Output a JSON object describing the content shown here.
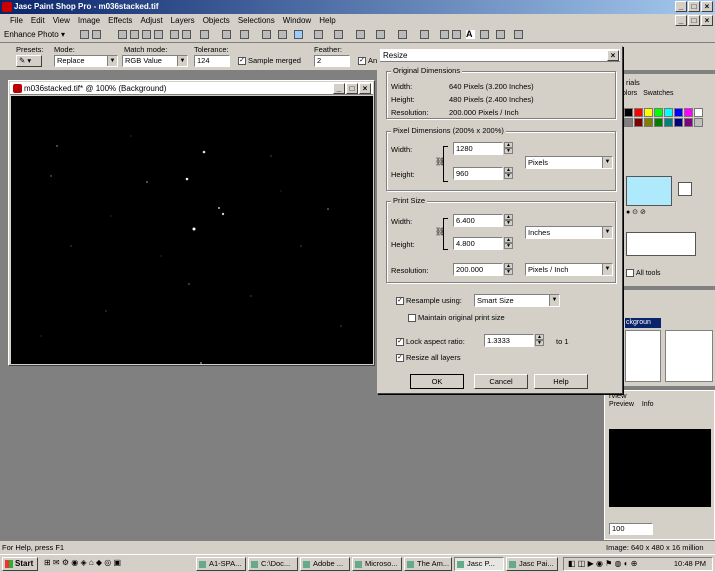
{
  "app": {
    "title": "Jasc Paint Shop Pro - m036stacked.tif",
    "menu": [
      "File",
      "Edit",
      "View",
      "Image",
      "Effects",
      "Adjust",
      "Layers",
      "Objects",
      "Selections",
      "Window",
      "Help"
    ],
    "enhance_label": "Enhance Photo",
    "icons": [
      "eye-icon",
      "arrow-icon",
      "selection-icon",
      "crop-icon",
      "move-icon",
      "wand-icon",
      "brush-icon",
      "clone-icon",
      "eraser-icon",
      "fill-icon",
      "text-icon",
      "pen-icon"
    ]
  },
  "options_bar": {
    "presets_label": "Presets:",
    "mode_label": "Mode:",
    "mode_value": "Replace",
    "match_label": "Match mode:",
    "match_value": "RGB Value",
    "tolerance_label": "Tolerance:",
    "tolerance_value": "124",
    "sample_merged": "Sample merged",
    "feather_label": "Feather:",
    "feather_value": "2",
    "antialias_label": "Ant"
  },
  "image_window": {
    "title": "m036stacked.tif* @ 100% (Background)"
  },
  "dialog": {
    "title": "Resize",
    "original": {
      "label": "Original Dimensions",
      "width_label": "Width:",
      "width_value": "640 Pixels (3.200 Inches)",
      "height_label": "Height:",
      "height_value": "480 Pixels (2.400 Inches)",
      "res_label": "Resolution:",
      "res_value": "200.000 Pixels / Inch"
    },
    "pixel": {
      "label": "Pixel Dimensions (200% x 200%)",
      "width_label": "Width:",
      "width_value": "1280",
      "height_label": "Height:",
      "height_value": "960",
      "unit": "Pixels"
    },
    "print": {
      "label": "Print Size",
      "width_label": "Width:",
      "width_value": "6.400",
      "height_label": "Height:",
      "height_value": "4.800",
      "unit": "Inches",
      "res_label": "Resolution:",
      "res_value": "200.000",
      "res_unit": "Pixels / Inch"
    },
    "resample_label": "Resample using:",
    "resample_value": "Smart Size",
    "maintain_label": "Maintain original print size",
    "lock_label": "Lock aspect ratio:",
    "lock_value": "1.3333",
    "lock_suffix": "to 1",
    "resize_layers_label": "Resize all layers",
    "ok": "OK",
    "cancel": "Cancel",
    "help": "Help"
  },
  "palettes": {
    "materials_tab1": "olors",
    "materials_tab2": "Swatches",
    "materials_title": "rials",
    "all_tools": "All tools",
    "layer_tab1": "ckgroun",
    "overview_title": "rview",
    "overview_tab": "Preview",
    "info_tab": "Info",
    "zoom_value": "100",
    "swatch_colors": [
      "#000000",
      "#ff0000",
      "#ffff00",
      "#00ff00",
      "#00ffff",
      "#0000ff",
      "#ff00ff",
      "#ffffff",
      "#808080",
      "#800000",
      "#808000",
      "#008000",
      "#008080",
      "#000080",
      "#800080",
      "#c0c0c0"
    ],
    "fg_color": "#aeeafb"
  },
  "status": {
    "help": "For Help, press F1",
    "image_info": "Image:  640 x 480 x 16 million"
  },
  "taskbar": {
    "start": "Start",
    "tasks": [
      "A1-SPA...",
      "C:\\Doc...",
      "Adobe ...",
      "Microso...",
      "The Am...",
      "Jasc P...",
      "Jasc Pai..."
    ],
    "clock": "10:48 PM"
  }
}
